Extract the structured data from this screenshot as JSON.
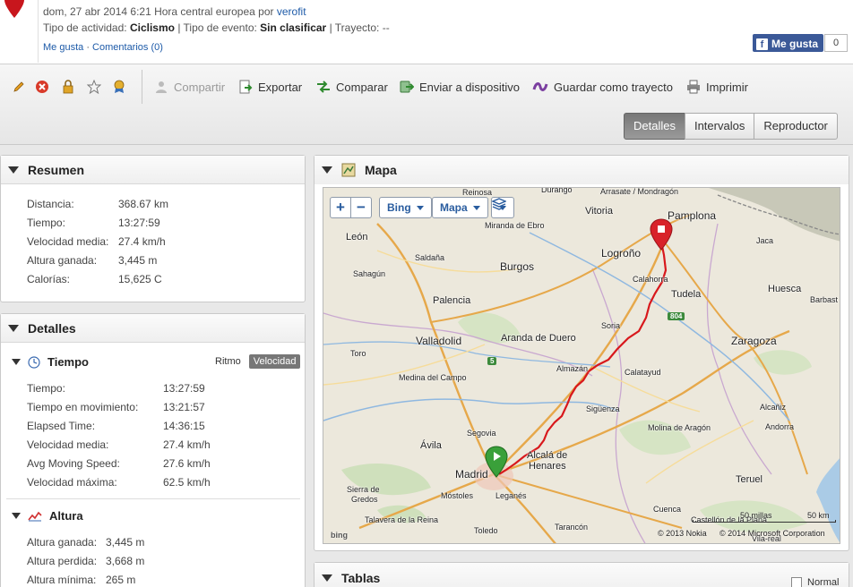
{
  "header": {
    "date_line_prefix": "dom, 27 abr 2014 6:21 Hora central europea por",
    "user": "verofit",
    "activity_label": "Tipo de actividad:",
    "activity_value": "Ciclismo",
    "event_label": "| Tipo de evento:",
    "event_value": "Sin clasificar",
    "route_label": "| Trayecto: --",
    "like_link": "Me gusta",
    "dot": "·",
    "comments_link": "Comentarios (0)",
    "fb_label": "Me gusta",
    "fb_count": "0"
  },
  "toolbar": {
    "actions": [
      {
        "label": "Compartir",
        "icon": "share-icon",
        "disabled": true
      },
      {
        "label": "Exportar",
        "icon": "export-icon"
      },
      {
        "label": "Comparar",
        "icon": "compare-icon"
      },
      {
        "label": "Enviar a dispositivo",
        "icon": "send-device-icon"
      },
      {
        "label": "Guardar como trayecto",
        "icon": "save-route-icon"
      },
      {
        "label": "Imprimir",
        "icon": "print-icon"
      }
    ],
    "tabs": [
      "Detalles",
      "Intervalos",
      "Reproductor"
    ],
    "active_tab": "Detalles"
  },
  "resumen": {
    "title": "Resumen",
    "rows": [
      {
        "label": "Distancia:",
        "value": "368.67 km"
      },
      {
        "label": "Tiempo:",
        "value": "13:27:59"
      },
      {
        "label": "Velocidad media:",
        "value": "27.4 km/h"
      },
      {
        "label": "Altura ganada:",
        "value": "3,445 m"
      },
      {
        "label": "Calorías:",
        "value": "15,625 C"
      }
    ]
  },
  "detalles": {
    "title": "Detalles",
    "tiempo": {
      "title": "Tiempo",
      "ritmo": "Ritmo",
      "velocidad": "Velocidad",
      "rows": [
        {
          "label": "Tiempo:",
          "value": "13:27:59"
        },
        {
          "label": "Tiempo en movimiento:",
          "value": "13:21:57"
        },
        {
          "label": "Elapsed Time:",
          "value": "14:36:15"
        },
        {
          "label": "Velocidad media:",
          "value": "27.4 km/h"
        },
        {
          "label": "Avg Moving Speed:",
          "value": "27.6 km/h"
        },
        {
          "label": "Velocidad máxima:",
          "value": "62.5 km/h"
        }
      ]
    },
    "altura": {
      "title": "Altura",
      "rows": [
        {
          "label": "Altura ganada:",
          "value": "3,445 m"
        },
        {
          "label": "Altura perdida:",
          "value": "3,668 m"
        },
        {
          "label": "Altura mínima:",
          "value": "265 m"
        }
      ]
    }
  },
  "mapa": {
    "title": "Mapa",
    "zoom_in": "+",
    "zoom_out": "−",
    "provider": "Bing",
    "view": "Mapa",
    "cities": {
      "durango": "Durango",
      "arrasate": "Arrasate / Mondragón",
      "reinosa": "Reinosa",
      "vitoria": "Vitoria",
      "pamplona": "Pamplona",
      "leon": "León",
      "miranda": "Miranda de Ebro",
      "saldana": "Saldaña",
      "burgos": "Burgos",
      "logrono": "Logroño",
      "jaca": "Jaca",
      "sahagun": "Sahagún",
      "calahorra": "Calahorra",
      "huesca": "Huesca",
      "palencia": "Palencia",
      "tudela": "Tudela",
      "barbast": "Barbast",
      "valladolid": "Valladolid",
      "aranda": "Aranda de Duero",
      "soria": "Soria",
      "zaragoza": "Zaragoza",
      "toro": "Toro",
      "almazan": "Almazán",
      "calatayud": "Calatayud",
      "medina": "Medina del Campo",
      "siguenza": "Sigüenza",
      "alcaniz": "Alcañiz",
      "segovia": "Segovia",
      "andorra": "Andorra",
      "molina": "Molina de Aragón",
      "avila": "Ávila",
      "alcala": "Alcalá de",
      "henares": "Henares",
      "madrid": "Madrid",
      "mostoles": "Móstoles",
      "leganes": "Leganés",
      "sierra": "Sierra de",
      "gredos": "Gredos",
      "teruel": "Teruel",
      "talavera": "Talavera de la Reina",
      "cuenca": "Cuenca",
      "toledo": "Toledo",
      "tarancon": "Tarancón",
      "castellon": "Castellón de la Plana",
      "vilareal": "Vila-real"
    },
    "road_5": "5",
    "road_804": "804",
    "scale_miles": "50 millas",
    "scale_km": "50 km",
    "copyright_nokia": "© 2013 Nokia",
    "copyright_ms": "© 2014 Microsoft Corporation",
    "bing_logo": "bing"
  },
  "tablas": {
    "title": "Tablas",
    "normal_label": "Normal"
  },
  "colors": {
    "route": "#d8181c",
    "active_tab": "#7a7a7a",
    "link": "#1d5aa8",
    "fb": "#3b5998"
  }
}
